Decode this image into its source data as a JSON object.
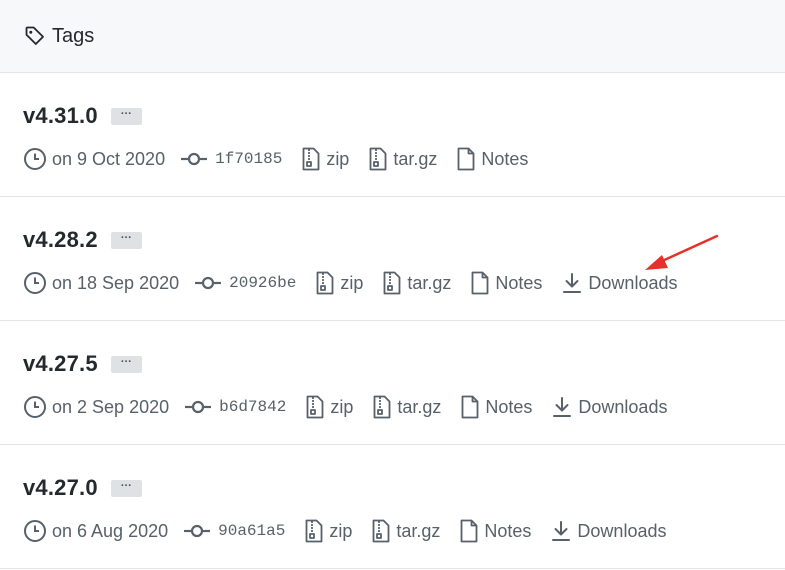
{
  "header": {
    "title": "Tags",
    "icon": "tag-icon"
  },
  "colors": {
    "annotation_arrow": "#e8302b",
    "badge_bg": "#dfe2e5",
    "header_bg": "#f6f8fa"
  },
  "releases": [
    {
      "version": "v4.31.0",
      "ellipsis": "···",
      "date": "on 9 Oct 2020",
      "sha": "1f70185",
      "zip": "zip",
      "targz": "tar.gz",
      "notes": "Notes",
      "downloads": ""
    },
    {
      "version": "v4.28.2",
      "ellipsis": "···",
      "date": "on 18 Sep 2020",
      "sha": "20926be",
      "zip": "zip",
      "targz": "tar.gz",
      "notes": "Notes",
      "downloads": "Downloads"
    },
    {
      "version": "v4.27.5",
      "ellipsis": "···",
      "date": "on 2 Sep 2020",
      "sha": "b6d7842",
      "zip": "zip",
      "targz": "tar.gz",
      "notes": "Notes",
      "downloads": "Downloads"
    },
    {
      "version": "v4.27.0",
      "ellipsis": "···",
      "date": "on 6 Aug 2020",
      "sha": "90a61a5",
      "zip": "zip",
      "targz": "tar.gz",
      "notes": "Notes",
      "downloads": "Downloads"
    }
  ]
}
